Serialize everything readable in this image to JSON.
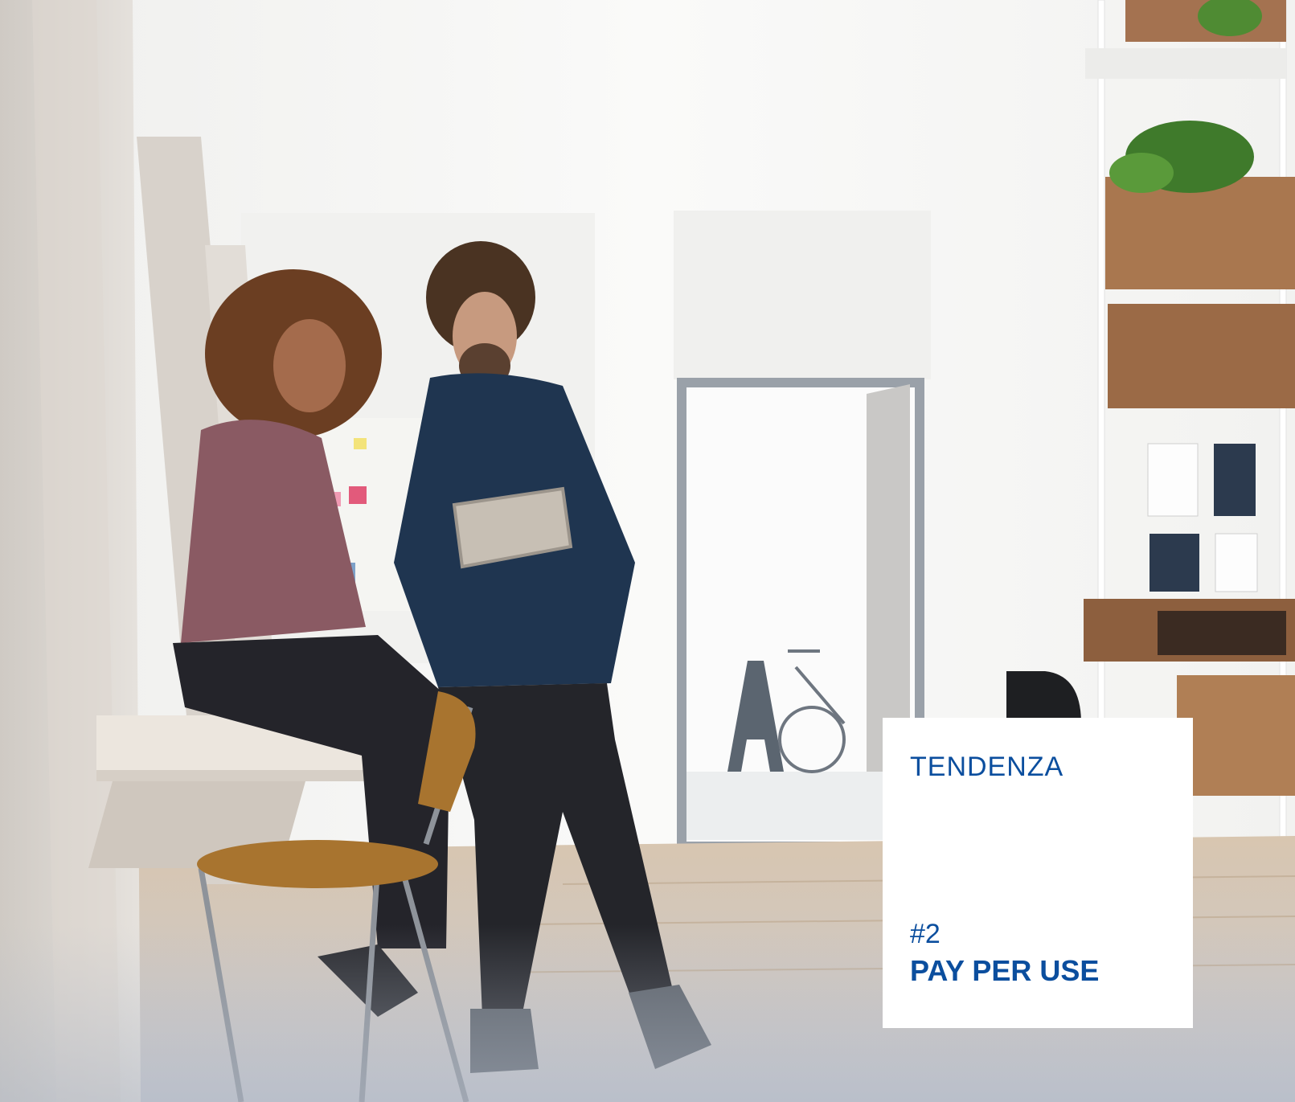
{
  "card": {
    "category": "TENDENZA",
    "number": "#2",
    "title": "PAY PER USE"
  },
  "colors": {
    "brand_blue": "#0b4e9e",
    "card_bg": "#ffffff",
    "wall": "#f6f6f4",
    "floor": "#c9b39a",
    "wood": "#a0704a",
    "shirt_man": "#1f3550",
    "shirt_woman": "#8a5a63"
  },
  "photo": {
    "subject": "office-scene-two-people-with-tablet"
  }
}
